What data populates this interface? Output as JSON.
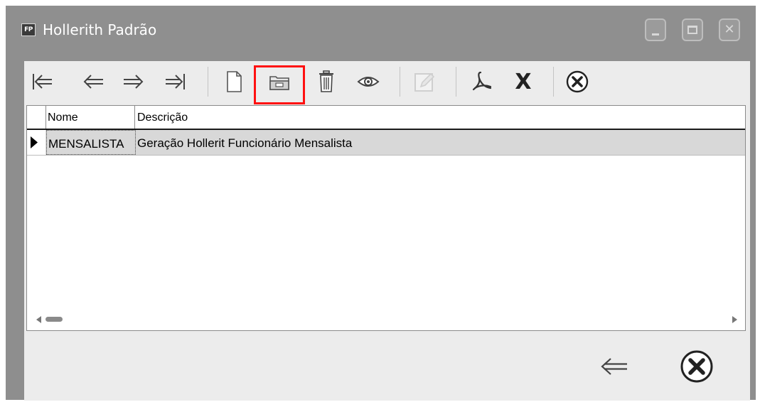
{
  "window": {
    "app_badge": "FP",
    "title": "Hollerith Padrão"
  },
  "toolbar": {
    "buttons": [
      {
        "name": "first-record-icon"
      },
      {
        "name": "previous-record-icon"
      },
      {
        "name": "next-record-icon"
      },
      {
        "name": "last-record-icon"
      },
      {
        "name": "new-document-icon"
      },
      {
        "name": "open-folder-icon",
        "highlighted": true
      },
      {
        "name": "trash-icon"
      },
      {
        "name": "eye-icon"
      },
      {
        "name": "edit-icon",
        "disabled": true
      },
      {
        "name": "pdf-icon"
      },
      {
        "name": "excel-icon",
        "label": "X"
      },
      {
        "name": "close-circle-icon"
      }
    ],
    "highlight_color": "#ff1010"
  },
  "grid": {
    "columns": [
      "Nome",
      "Descrição"
    ],
    "rows": [
      {
        "nome": "MENSALISTA",
        "descricao": "Geração Hollerit Funcionário Mensalista"
      }
    ]
  },
  "footer": {
    "buttons": [
      {
        "name": "back-arrow-icon"
      },
      {
        "name": "close-circle-icon"
      }
    ]
  },
  "colors": {
    "titlebar": "#8f8f8f",
    "client": "#ececec",
    "selected_row": "#d8d8d8"
  }
}
